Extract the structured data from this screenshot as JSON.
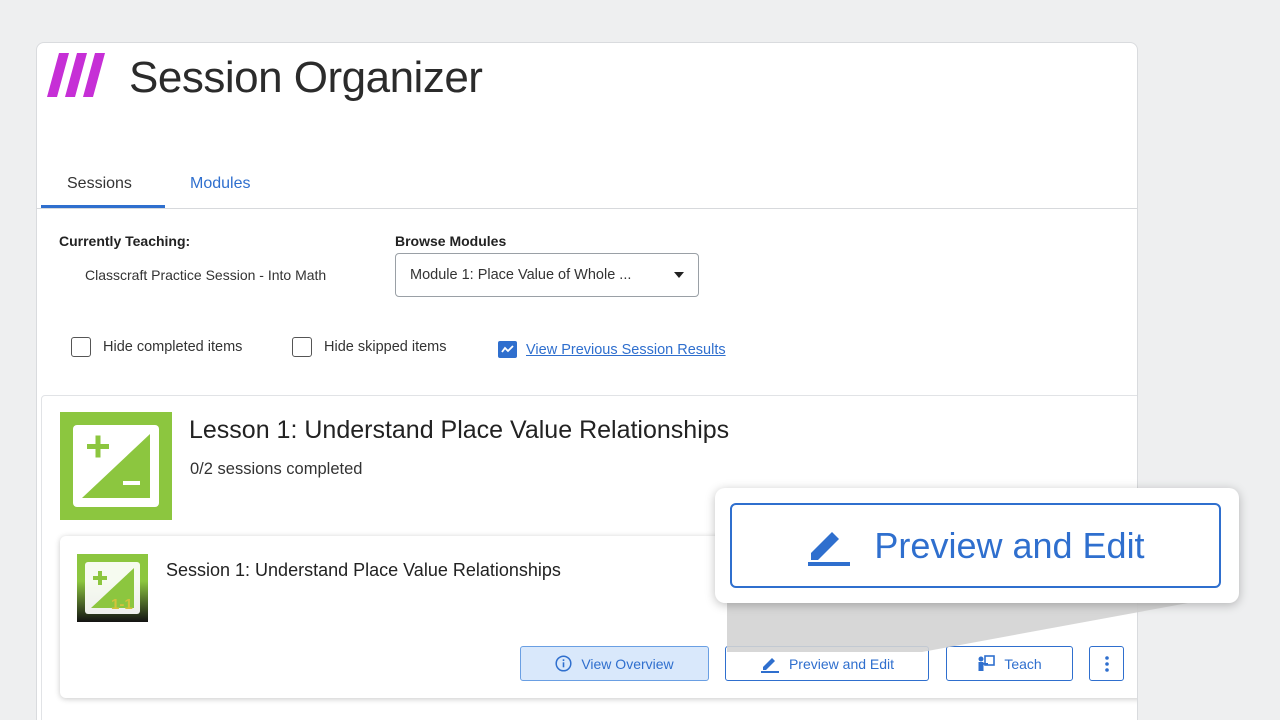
{
  "app": {
    "title": "Session Organizer",
    "logo_icon": "brand-stripes-logo",
    "brand_color": "#c62fd6"
  },
  "tabs": [
    {
      "label": "Sessions",
      "active": true
    },
    {
      "label": "Modules",
      "active": false
    }
  ],
  "teaching": {
    "label": "Currently Teaching:",
    "value": "Classcraft Practice Session - Into Math"
  },
  "browse": {
    "label": "Browse Modules",
    "selected": "Module 1: Place Value of Whole ..."
  },
  "filters": {
    "hide_completed": "Hide completed items",
    "hide_skipped": "Hide skipped items",
    "view_results": "View Previous Session Results"
  },
  "lesson": {
    "title": "Lesson 1: Understand Place Value Relationships",
    "progress": "0/2 sessions completed",
    "badge_color": "#8cc63f"
  },
  "session": {
    "title": "Session 1: Understand Place Value Relationships",
    "badge_text": "1-1",
    "buttons": {
      "overview": "View Overview",
      "preview": "Preview and Edit",
      "teach": "Teach"
    }
  },
  "callout": {
    "label": "Preview and Edit"
  },
  "colors": {
    "accent": "#2f6fce",
    "lesson_green": "#8cc63f"
  }
}
